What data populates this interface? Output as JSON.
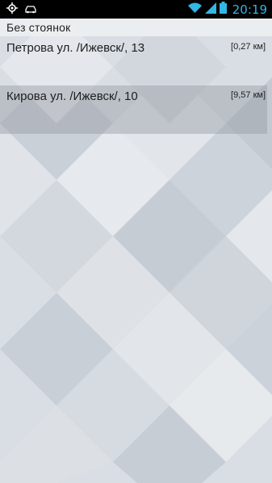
{
  "status_bar": {
    "time": "20:19",
    "icons_left": [
      "gps-icon",
      "car-icon"
    ],
    "icons_right": [
      "wifi-icon",
      "signal-icon",
      "battery-icon"
    ],
    "accent_color": "#33b5e5"
  },
  "list": {
    "section_header": "Без стоянок",
    "items": [
      {
        "address": "Петрова ул. /Ижевск/, 13",
        "distance": "[0,27 км]",
        "selected": false
      },
      {
        "address": "Кирова ул. /Ижевск/, 10",
        "distance": "[9,57 км]",
        "selected": true
      }
    ]
  }
}
